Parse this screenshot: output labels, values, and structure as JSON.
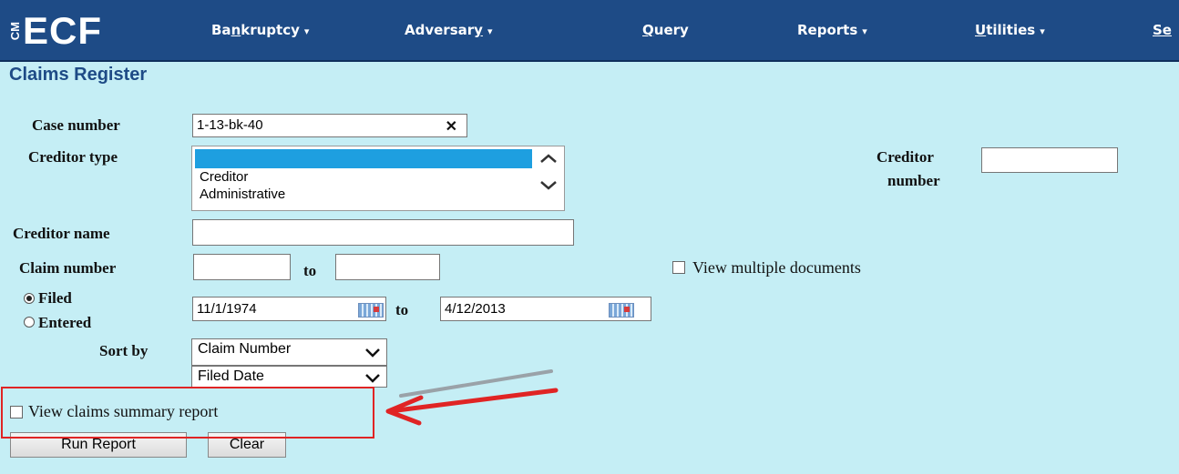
{
  "nav": {
    "logo_small": "CM",
    "logo_big": "ECF",
    "items": [
      {
        "pre": "Ba",
        "ul": "n",
        "post": "kruptcy",
        "caret": true
      },
      {
        "pre": "Adversar",
        "ul": "y",
        "post": "",
        "caret": true
      },
      {
        "pre": "",
        "ul": "Q",
        "post": "uery",
        "caret": false
      },
      {
        "pre": "Reports",
        "ul": "",
        "post": "",
        "caret": true
      },
      {
        "pre": "",
        "ul": "U",
        "post": "tilities",
        "caret": true
      },
      {
        "pre": "",
        "ul": "Se",
        "post": "",
        "caret": false
      }
    ],
    "caret_glyph": "▾"
  },
  "page": {
    "title": "Claims Register"
  },
  "form": {
    "case_number_label": "Case number",
    "case_number_value": "1-13-bk-40",
    "clear_glyph": "✕",
    "creditor_type_label": "Creditor type",
    "creditor_type_options": [
      "",
      "Creditor",
      "Administrative"
    ],
    "creditor_number_label_1": "Creditor",
    "creditor_number_label_2": "number",
    "creditor_number_value": "",
    "creditor_name_label": "Creditor name",
    "creditor_name_value": "",
    "claim_number_label": "Claim number",
    "claim_from_value": "",
    "to_label": "to",
    "claim_to_value": "",
    "view_multiple_label": "View multiple documents",
    "filed_label": "Filed",
    "entered_label": "Entered",
    "date_from": "11/1/1974",
    "date_to": "4/12/2013",
    "sort_by_label": "Sort by",
    "sort_primary": "Claim Number",
    "sort_secondary": "Filed Date",
    "chev_glyph": "⌄",
    "summary_label": "View claims summary report",
    "run_report": "Run Report",
    "clear": "Clear"
  },
  "colors": {
    "annotation": "#e02424",
    "nav_bg": "#1e4b86",
    "page_bg": "#c5eef5"
  }
}
